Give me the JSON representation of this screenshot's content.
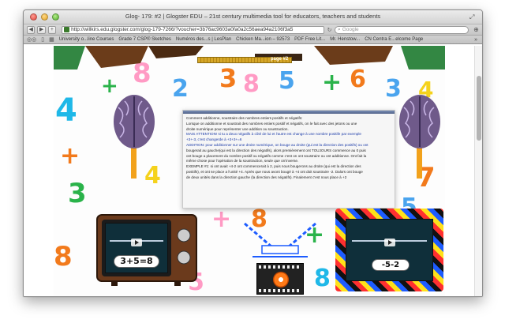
{
  "window": {
    "title": "Glog- 179: #2 | Glogster EDU – 21st century multimedia tool for educators, teachers and students"
  },
  "toolbar": {
    "url": "http://willkirs.edu.glogster.com/glog-179-7266/?voucher=3b76ac9603a0fa0a2c56aea94a2106f3a5",
    "search_placeholder": "Google"
  },
  "bookmarks": [
    "University o...line Courses",
    "Grade 7 CSP® Sketches",
    "Numéros des...s | LesPlan",
    "Chicken Ma...ion – 92573",
    "PDF Free Lit...",
    "Mr. Henstow...",
    "CN Centra E...elcome Page"
  ],
  "glog": {
    "page_label": "page #2",
    "text_lines": [
      {
        "text": "Comment additionne, soustraire des nombres entiers positifs et négatifs:",
        "tone": "dark"
      },
      {
        "text": "Lorsque on additionne et soustrait des nombres entiers positif et négatifs, on le fait avec des jetons ou une",
        "tone": "dark"
      },
      {
        "text": "droite numérique pour représenter une addition ou soustraction.",
        "tone": "dark"
      },
      {
        "text": "MAIS ATTENTION! si tu a deux négatifs à côté de lui et l'autre est change à une nombre positife par exemple",
        "tone": "blue"
      },
      {
        "text": "+3+-3, c'est changerde à +3+3+=6",
        "tone": "blue"
      },
      {
        "text": "ADDITION: pour additionner sur une droite numérique, on bouge au droite (qui est la direction des positifs) ou ont",
        "tone": "blue"
      },
      {
        "text": "bougerait au gauche(qui est la direction des négatifs), alors premièrement ont TOUJOURS commence au 0 puis",
        "tone": "dark"
      },
      {
        "text": "ont bouge a placement du nombre positif ou négatifs comme c'est on ont soustraire ou ont additionne. Ont fait la",
        "tone": "dark"
      },
      {
        "text": "même chose pour l'opération de la soustraction, seule que on'inverse.",
        "tone": "dark"
      },
      {
        "text": "EXEMPLE #1: si ont avait  +4-2 ont commencerait à 2, puis nous bougerons au droite (qui est la direction des",
        "tone": "dark"
      },
      {
        "text": "positifs), et ont se place a l'unité +4. Après que nous avont bougé à +4 ont doit soustraire -2. Dalors ont bouge",
        "tone": "dark"
      },
      {
        "text": "de deux unités dans la direction gauche (la direction des négatifs). Finalement c'est nous place à +2",
        "tone": "dark"
      }
    ],
    "video_left_equation": "3+5=8",
    "video_right_equation": "-5-2"
  },
  "colors": {
    "accent": "#3a7a2c",
    "banner_brown": "#6b3c1a"
  }
}
